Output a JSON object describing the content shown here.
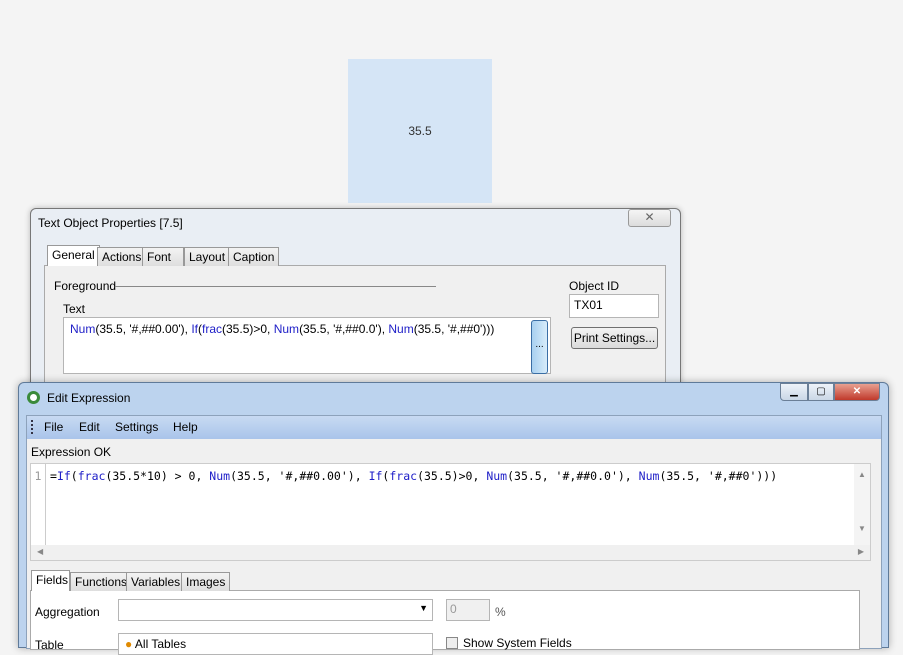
{
  "canvas_object": {
    "value": "35.5",
    "color": "#d5e5f6"
  },
  "text_object_dialog": {
    "title": "Text Object Properties [7.5]",
    "close_label": "✕",
    "tabs": [
      "General",
      "Actions",
      "Font",
      "Layout",
      "Caption"
    ],
    "foreground_label": "Foreground",
    "text_label": "Text",
    "text_tokens": [
      {
        "t": "Num",
        "k": "fn"
      },
      {
        "t": "(35.5, '#,##0.00'), ",
        "k": "p"
      },
      {
        "t": "If",
        "k": "fn"
      },
      {
        "t": "(",
        "k": "p"
      },
      {
        "t": "frac",
        "k": "fn"
      },
      {
        "t": "(35.5)>0, ",
        "k": "p"
      },
      {
        "t": "Num",
        "k": "fn"
      },
      {
        "t": "(35.5, '#,##0.0'), ",
        "k": "p"
      },
      {
        "t": "Num",
        "k": "fn"
      },
      {
        "t": "(35.5, '#,##0')))",
        "k": "p"
      }
    ],
    "ellipsis_label": "...",
    "object_id_label": "Object ID",
    "object_id_value": "TX01",
    "print_settings_label": "Print Settings..."
  },
  "edit_expression": {
    "title": "Edit Expression",
    "menu": [
      "File",
      "Edit",
      "Settings",
      "Help"
    ],
    "status": "Expression OK",
    "line_number": "1",
    "tokens": [
      {
        "t": "=",
        "k": "p"
      },
      {
        "t": "If",
        "k": "fn"
      },
      {
        "t": "(",
        "k": "p"
      },
      {
        "t": "frac",
        "k": "fn"
      },
      {
        "t": "(35.5*10) > 0, ",
        "k": "p"
      },
      {
        "t": "Num",
        "k": "fn"
      },
      {
        "t": "(35.5, '#,##0.00'), ",
        "k": "p"
      },
      {
        "t": "If",
        "k": "fn"
      },
      {
        "t": "(",
        "k": "p"
      },
      {
        "t": "frac",
        "k": "fn"
      },
      {
        "t": "(35.5)>0, ",
        "k": "p"
      },
      {
        "t": "Num",
        "k": "fn"
      },
      {
        "t": "(35.5, '#,##0.0'), ",
        "k": "p"
      },
      {
        "t": "Num",
        "k": "fn"
      },
      {
        "t": "(35.5, '#,##0')))",
        "k": "p"
      }
    ],
    "tabs": [
      "Fields",
      "Functions",
      "Variables",
      "Images"
    ],
    "aggregation_label": "Aggregation",
    "aggregation_value": "",
    "percent_value": "0",
    "percent_unit": "%",
    "table_label": "Table",
    "table_value": "All Tables",
    "show_system_fields_label": "Show System Fields",
    "show_system_fields_checked": false
  }
}
